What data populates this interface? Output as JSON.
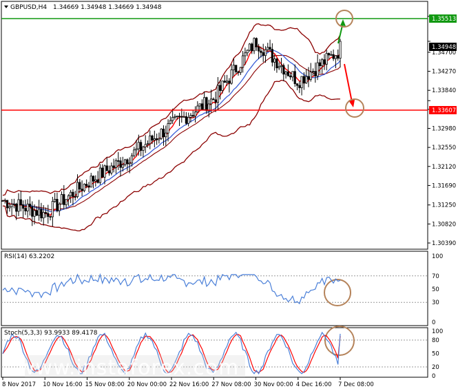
{
  "chart_header": {
    "symbol_label": "GBPUSD,H4",
    "ohlc_label": "1.34669 1.34948 1.34669 1.34948"
  },
  "price_axis": {
    "ticks": [
      "1.35513",
      "1.34948",
      "1.34700",
      "1.34270",
      "1.33840",
      "1.33607",
      "1.33410",
      "1.32980",
      "1.32550",
      "1.32120",
      "1.31690",
      "1.31250",
      "1.30820",
      "1.30390"
    ],
    "resistance_label": "1.35513",
    "current_label": "1.34948",
    "support_label": "1.33607"
  },
  "rsi_panel": {
    "label": "RSI(14) 63.2202",
    "ticks": [
      "100",
      "70",
      "50",
      "30",
      "0"
    ]
  },
  "stoch_panel": {
    "label": "Stoch(5,3,3) 93.9933 89.4178",
    "ticks": [
      "100",
      "80",
      "50",
      "20",
      "0"
    ]
  },
  "time_axis": {
    "labels": [
      "8 Nov 2017",
      "10 Nov 16:00",
      "15 Nov 08:00",
      "20 Nov 00:00",
      "22 Nov 16:00",
      "27 Nov 08:00",
      "30 Nov 00:00",
      "4 Dec 16:00",
      "7 Dec 08:00"
    ]
  },
  "watermark": {
    "text": "www.instaforex.com"
  },
  "colors": {
    "candle": "#000000",
    "bollinger": "#8b0000",
    "ma_fast": "#ff0000",
    "ma_slow": "#3a5fd8",
    "resistance": "#119911",
    "support": "#ff0000",
    "rsi": "#4a7fd8",
    "stoch_main": "#4a7fd8",
    "stoch_signal": "#ff0000",
    "circle": "#b5835a"
  },
  "chart_data": [
    {
      "type": "line",
      "title": "GBPUSD,H4",
      "ylim": [
        1.3025,
        1.3585
      ],
      "x": [
        "8 Nov 2017",
        "10 Nov 16:00",
        "15 Nov 08:00",
        "20 Nov 00:00",
        "22 Nov 16:00",
        "27 Nov 08:00",
        "30 Nov 00:00",
        "4 Dec 16:00",
        "7 Dec 08:00"
      ],
      "series": [
        {
          "values": [
            1.3135,
            1.3105,
            1.3175,
            1.3235,
            1.3305,
            1.3365,
            1.3495,
            1.3405,
            1.3475
          ]
        }
      ],
      "horizontal_lines": [
        1.35513,
        1.33607
      ],
      "last_price": 1.34948
    },
    {
      "type": "line",
      "title": "RSI(14) 63.2202",
      "ylim": [
        0,
        100
      ],
      "last_value": 63.2202
    },
    {
      "type": "line",
      "title": "Stoch(5,3,3) 93.9933 89.4178",
      "ylim": [
        0,
        100
      ],
      "last_main": 93.9933,
      "last_signal": 89.4178
    }
  ]
}
